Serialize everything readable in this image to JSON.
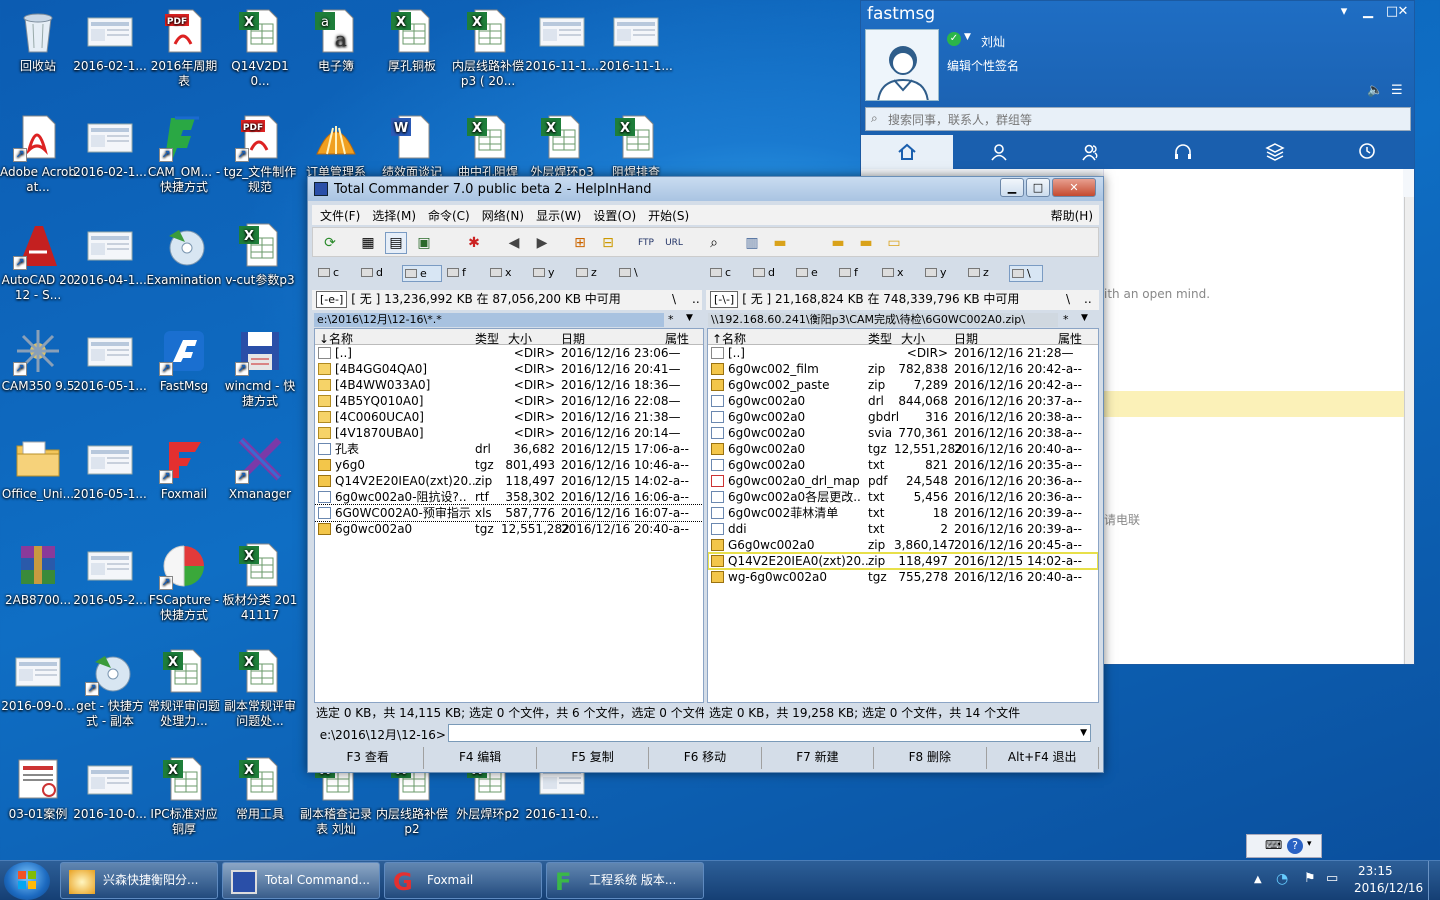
{
  "desktop_icons": [
    {
      "label": "回收站",
      "icon": "recycle-bin"
    },
    {
      "label": "2016-02-1...",
      "icon": "image-thumbnail"
    },
    {
      "label": "2016年周期表",
      "icon": "pdf-file"
    },
    {
      "label": "Q14V2D10...",
      "icon": "excel-file"
    },
    {
      "label": "电子簿",
      "icon": "text-file"
    },
    {
      "label": "厚孔铜板",
      "icon": "excel-file"
    },
    {
      "label": "内层线路补偿p3 ( 20...",
      "icon": "excel-file"
    },
    {
      "label": "2016-11-1...",
      "icon": "image-thumbnail"
    },
    {
      "label": "2016-11-1...",
      "icon": "image-thumbnail"
    },
    {
      "label": "Adobe Acrobat...",
      "icon": "pdf-app"
    },
    {
      "label": "2016-02-1...",
      "icon": "image-thumbnail"
    },
    {
      "label": "CAM_OM... - 快捷方式",
      "icon": "app-shortcut"
    },
    {
      "label": "tgz_文件制作规范",
      "icon": "pdf-file"
    },
    {
      "label": "订单管理系",
      "icon": "shell-app"
    },
    {
      "label": "绩效面谈记",
      "icon": "word-file"
    },
    {
      "label": "曲中孔阻焊",
      "icon": "excel-file"
    },
    {
      "label": "外层焊环p3",
      "icon": "excel-file"
    },
    {
      "label": "阻焊排查",
      "icon": "excel-file"
    },
    {
      "label": "AutoCAD 2012 - S...",
      "icon": "autocad-app"
    },
    {
      "label": "2016-04-1...",
      "icon": "image-thumbnail"
    },
    {
      "label": "Examination",
      "icon": "disc-app"
    },
    {
      "label": "v-cut参数p3",
      "icon": "excel-file"
    },
    {
      "label": "CAM350 9.5",
      "icon": "cam-app"
    },
    {
      "label": "2016-05-1...",
      "icon": "image-thumbnail"
    },
    {
      "label": "FastMsg",
      "icon": "fastmsg-app"
    },
    {
      "label": "wincmd - 快捷方式",
      "icon": "save-app"
    },
    {
      "label": "Office_Uni...",
      "icon": "folder"
    },
    {
      "label": "2016-05-1...",
      "icon": "image-thumbnail"
    },
    {
      "label": "Foxmail",
      "icon": "foxmail-app"
    },
    {
      "label": "Xmanager",
      "icon": "xmanager-app"
    },
    {
      "label": "2AB8700...",
      "icon": "rar-file"
    },
    {
      "label": "2016-05-2...",
      "icon": "image-thumbnail"
    },
    {
      "label": "FSCapture - 快捷方式",
      "icon": "capture-app"
    },
    {
      "label": "板材分类 20141117",
      "icon": "excel-file"
    },
    {
      "label": "2016-09-0...",
      "icon": "image-thumbnail"
    },
    {
      "label": "get - 快捷方式 - 副本",
      "icon": "disc-app"
    },
    {
      "label": "常规评审问题处理力...",
      "icon": "excel-file"
    },
    {
      "label": "副本常规评审问题处...",
      "icon": "excel-file"
    },
    {
      "label": "03-01案例",
      "icon": "document-image"
    },
    {
      "label": "2016-10-0...",
      "icon": "image-thumbnail"
    },
    {
      "label": "IPC标准对应铜厚",
      "icon": "excel-file"
    },
    {
      "label": "常用工具",
      "icon": "excel-file"
    },
    {
      "label": "副本稽查记录表 刘灿",
      "icon": "excel-file"
    },
    {
      "label": "内层线路补偿p2",
      "icon": "excel-file"
    },
    {
      "label": "外层焊环p2",
      "icon": "excel-file"
    },
    {
      "label": "2016-11-0...",
      "icon": "image-thumbnail"
    }
  ],
  "fastmsg": {
    "title": "fastmsg",
    "username": "刘灿",
    "signature": "编辑个性签名",
    "search_placeholder": "搜索同事，联系人，群组等",
    "status": "online",
    "bg_text1": "ith an open mind.",
    "bg_text2": "请电联"
  },
  "tc": {
    "title": "Total Commander 7.0 public beta 2 - HelpInHand",
    "menu": [
      "文件(F)",
      "选择(M)",
      "命令(C)",
      "网络(N)",
      "显示(W)",
      "设置(O)",
      "开始(S)"
    ],
    "help": "帮助(H)",
    "drives": [
      "c",
      "d",
      "e",
      "f",
      "x",
      "y",
      "z",
      "\\"
    ],
    "left": {
      "drive_combo": "[-e-]",
      "free": "[ 无 ]  13,236,992 KB 在 87,056,200 KB 中可用",
      "root": "\\",
      "up": "..",
      "path": "e:\\2016\\12月\\12-16\\*.*",
      "headers": [
        "↓名称",
        "类型",
        "大小",
        "日期",
        "属性"
      ],
      "files": [
        {
          "name": "[..]",
          "type": "",
          "size": "<DIR>",
          "date": "2016/12/16 23:06—",
          "icon": "up"
        },
        {
          "name": "[4B4GG04QA0]",
          "type": "",
          "size": "<DIR>",
          "date": "2016/12/16 20:41—",
          "icon": "folder"
        },
        {
          "name": "[4B4WW033A0]",
          "type": "",
          "size": "<DIR>",
          "date": "2016/12/16 18:36—",
          "icon": "folder"
        },
        {
          "name": "[4B5YQ010A0]",
          "type": "",
          "size": "<DIR>",
          "date": "2016/12/16 22:08—",
          "icon": "folder"
        },
        {
          "name": "[4C0060UCA0]",
          "type": "",
          "size": "<DIR>",
          "date": "2016/12/16 21:38—",
          "icon": "folder"
        },
        {
          "name": "[4V1870UBA0]",
          "type": "",
          "size": "<DIR>",
          "date": "2016/12/16 20:14—",
          "icon": "folder"
        },
        {
          "name": "孔表",
          "type": "drl",
          "size": "36,682",
          "date": "2016/12/15 17:06-a--",
          "icon": "doc"
        },
        {
          "name": "y6g0",
          "type": "tgz",
          "size": "801,493",
          "date": "2016/12/16 10:46-a--",
          "icon": "zip"
        },
        {
          "name": "Q14V2E20IEA0(zxt)20..",
          "type": "zip",
          "size": "118,497",
          "date": "2016/12/15 14:02-a--",
          "icon": "zip"
        },
        {
          "name": "6g0wc002a0-阻抗设?..",
          "type": "rtf",
          "size": "358,302",
          "date": "2016/12/16 16:06-a--",
          "icon": "doc"
        },
        {
          "name": "6G0WC002A0-预审指示",
          "type": "xls",
          "size": "587,776",
          "date": "2016/12/16 16:07-a--",
          "icon": "doc"
        },
        {
          "name": "6g0wc002a0",
          "type": "tgz",
          "size": "12,551,282",
          "date": "2016/12/16 20:40-a--",
          "icon": "zip"
        }
      ],
      "status": "选定 0 KB，共 14,115 KB; 选定 0 个文件，共 6 个文件，选定 0 个文件"
    },
    "right": {
      "drive_combo": "[-\\-]",
      "free": "[ 无 ]  21,168,824 KB 在 748,339,796 KB 中可用",
      "root": "\\",
      "up": "..",
      "path": "\\\\192.168.60.241\\衡阳p3\\CAM完成\\待检\\6G0WC002A0.zip\\",
      "headers": [
        "↑名称",
        "类型",
        "大小",
        "日期",
        "属性"
      ],
      "files": [
        {
          "name": "[..]",
          "type": "",
          "size": "<DIR>",
          "date": "2016/12/16 21:28—",
          "icon": "up"
        },
        {
          "name": "6g0wc002_film",
          "type": "zip",
          "size": "782,838",
          "date": "2016/12/16 20:42-a--",
          "icon": "zip"
        },
        {
          "name": "6g0wc002_paste",
          "type": "zip",
          "size": "7,289",
          "date": "2016/12/16 20:42-a--",
          "icon": "zip"
        },
        {
          "name": "6g0wc002a0",
          "type": "drl",
          "size": "844,068",
          "date": "2016/12/16 20:37-a--",
          "icon": "doc"
        },
        {
          "name": "6g0wc002a0",
          "type": "gbdrl",
          "size": "316",
          "date": "2016/12/16 20:38-a--",
          "icon": "doc"
        },
        {
          "name": "6g0wc002a0",
          "type": "svia",
          "size": "770,361",
          "date": "2016/12/16 20:38-a--",
          "icon": "doc"
        },
        {
          "name": "6g0wc002a0",
          "type": "tgz",
          "size": "12,551,282",
          "date": "2016/12/16 20:40-a--",
          "icon": "zip"
        },
        {
          "name": "6g0wc002a0",
          "type": "txt",
          "size": "821",
          "date": "2016/12/16 20:35-a--",
          "icon": "doc"
        },
        {
          "name": "6g0wc002a0_drl_map",
          "type": "pdf",
          "size": "24,548",
          "date": "2016/12/16 20:36-a--",
          "icon": "pdf"
        },
        {
          "name": "6g0wc002a0各层更改..",
          "type": "txt",
          "size": "5,456",
          "date": "2016/12/16 20:36-a--",
          "icon": "doc"
        },
        {
          "name": "6g0wc002菲林清单",
          "type": "txt",
          "size": "18",
          "date": "2016/12/16 20:39-a--",
          "icon": "doc"
        },
        {
          "name": "ddi",
          "type": "txt",
          "size": "2",
          "date": "2016/12/16 20:39-a--",
          "icon": "doc"
        },
        {
          "name": "G6g0wc002a0",
          "type": "zip",
          "size": "3,860,147",
          "date": "2016/12/16 20:45-a--",
          "icon": "zip"
        },
        {
          "name": "Q14V2E20IEA0(zxt)20..",
          "type": "zip",
          "size": "118,497",
          "date": "2016/12/15 14:02-a--",
          "icon": "zip"
        },
        {
          "name": "wg-6g0wc002a0",
          "type": "tgz",
          "size": "755,278",
          "date": "2016/12/16 20:40-a--",
          "icon": "zip"
        }
      ],
      "status": "选定 0 KB，共 19,258 KB; 选定 0 个文件，共 14 个文件"
    },
    "cmd_label": "e:\\2016\\12月\\12-16>",
    "fkeys": [
      "F3 查看",
      "F4 编辑",
      "F5 复制",
      "F6 移动",
      "F7 新建",
      "F8 删除",
      "Alt+F4 退出"
    ]
  },
  "taskbar": {
    "items": [
      "兴森快捷衡阳分...",
      "Total Command...",
      "Foxmail",
      "工程系统   版本..."
    ],
    "time": "23:15",
    "date": "2016/12/16"
  },
  "colors": {
    "desktop": "#1565c0",
    "taskbar": "#1d4a80",
    "fastmsg_blue": "#1a5fae",
    "tc_title": "#b6cde8",
    "highlight_outline": "#e8e04a"
  }
}
